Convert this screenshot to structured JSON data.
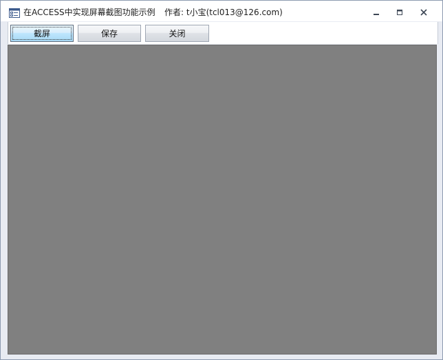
{
  "window": {
    "title": "在ACCESS中实现屏幕截图功能示例",
    "author": "作者: t小宝(tcl013@126.com)",
    "controls": {
      "minimize_icon": "minimize-icon",
      "restore_icon": "restore-icon",
      "close_icon": "close-icon"
    }
  },
  "toolbar": {
    "capture_label": "截屏",
    "save_label": "保存",
    "close_label": "关闭"
  },
  "colors": {
    "canvas": "#808080",
    "active_button": "#bee6fd"
  }
}
